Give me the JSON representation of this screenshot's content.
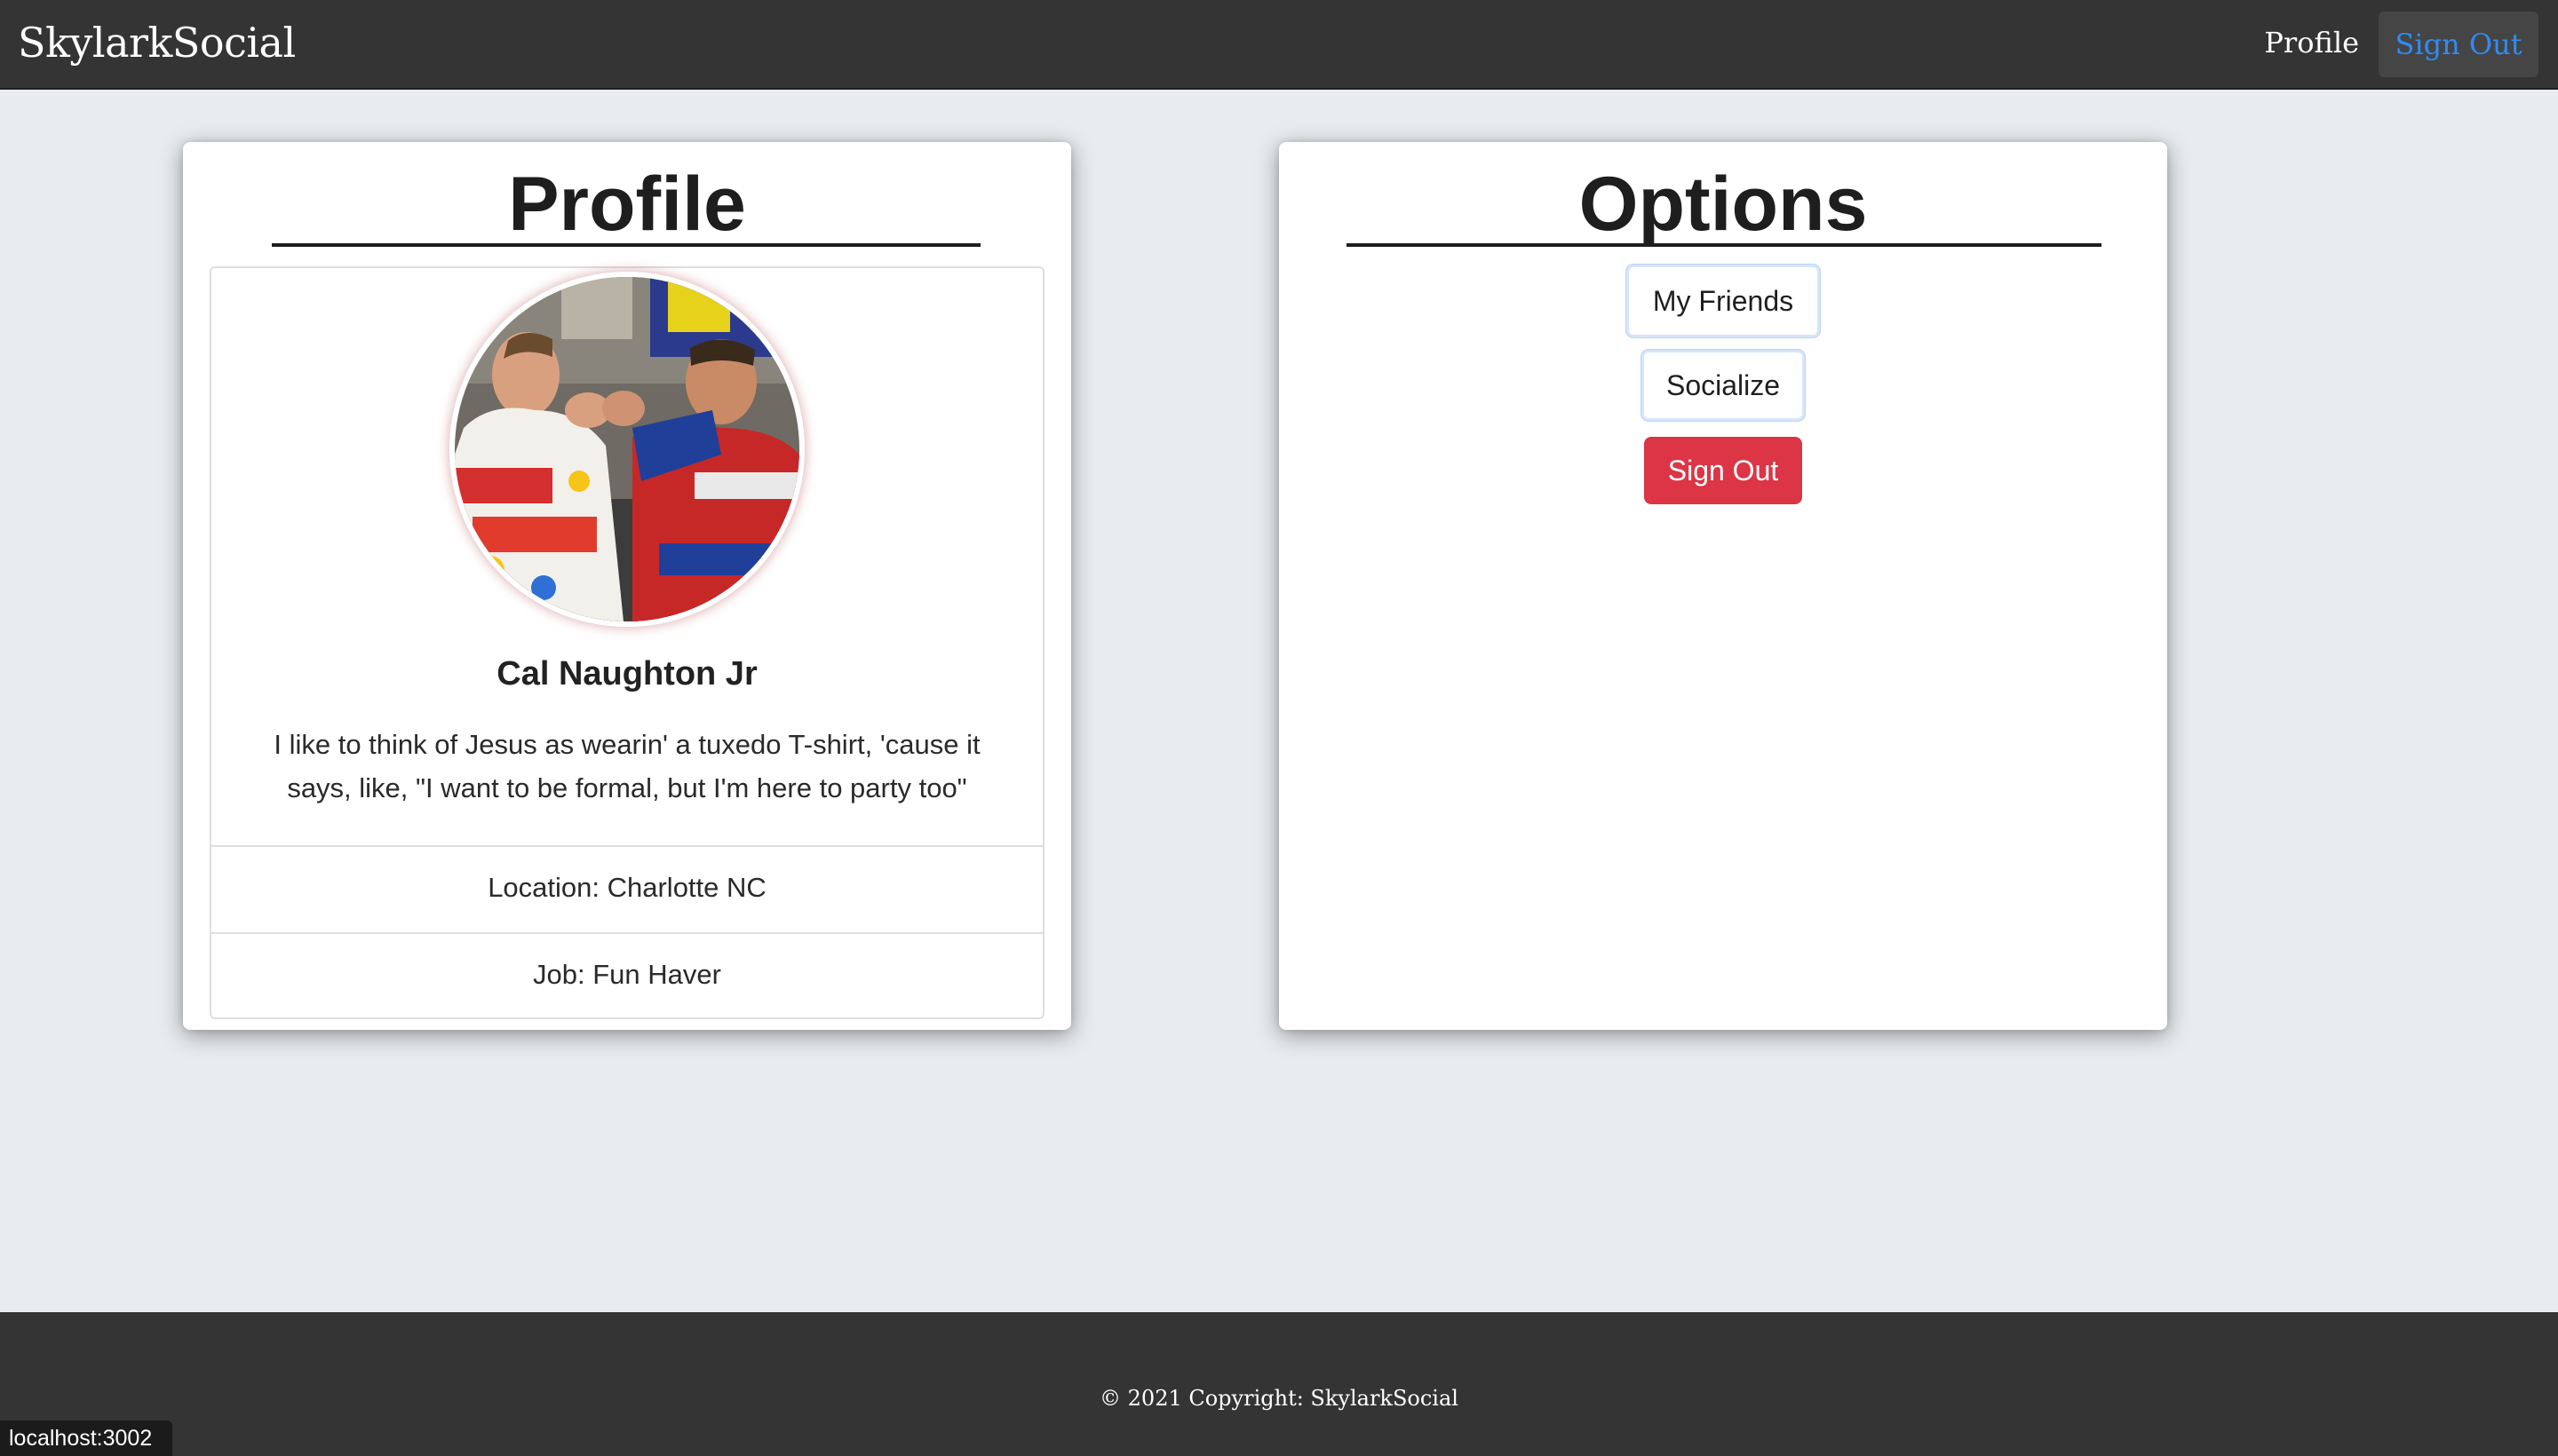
{
  "navbar": {
    "brand": "SkylarkSocial",
    "profile_link": "Profile",
    "sign_out": "Sign Out"
  },
  "profile_card": {
    "title": "Profile",
    "name": "Cal Naughton Jr",
    "bio": "I like to think of Jesus as wearin' a tuxedo T-shirt, 'cause it says, like, \"I want to be formal, but I'm here to party too\"",
    "location": "Location: Charlotte NC",
    "job": "Job: Fun Haver"
  },
  "options_card": {
    "title": "Options",
    "buttons": {
      "my_friends": "My Friends",
      "socialize": "Socialize",
      "sign_out": "Sign Out"
    }
  },
  "footer": {
    "copyright": "© 2021 Copyright: SkylarkSocial"
  },
  "status_bar": {
    "url": "localhost:3002"
  },
  "colors": {
    "navbar_bg": "#343434",
    "page_bg": "#e8ecef",
    "link_blue": "#2f8cf5",
    "danger": "#dc3545"
  }
}
